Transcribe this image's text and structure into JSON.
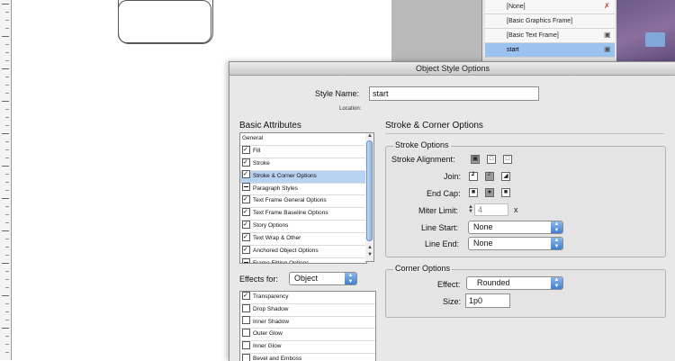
{
  "styles_panel": {
    "items": [
      {
        "label": "[None]",
        "icon": "pencil-clear-icon",
        "selected": false
      },
      {
        "label": "[Basic Graphics Frame]",
        "icon": "",
        "selected": false
      },
      {
        "label": "[Basic Text Frame]",
        "icon": "text-frame-icon",
        "selected": false
      },
      {
        "label": "start",
        "icon": "style-icon",
        "selected": true
      }
    ]
  },
  "dialog": {
    "title": "Object Style Options",
    "style_name_label": "Style Name:",
    "style_name_value": "start",
    "location_label": "Location:",
    "basic_attributes_title": "Basic Attributes",
    "attributes": [
      {
        "label": "General",
        "checkbox": "none"
      },
      {
        "label": "Fill",
        "checkbox": "checked"
      },
      {
        "label": "Stroke",
        "checkbox": "checked"
      },
      {
        "label": "Stroke & Corner Options",
        "checkbox": "checked",
        "selected": true
      },
      {
        "label": "Paragraph Styles",
        "checkbox": "mixed"
      },
      {
        "label": "Text Frame General Options",
        "checkbox": "checked"
      },
      {
        "label": "Text Frame Baseline Options",
        "checkbox": "checked"
      },
      {
        "label": "Story Options",
        "checkbox": "checked"
      },
      {
        "label": "Text Wrap & Other",
        "checkbox": "checked"
      },
      {
        "label": "Anchored Object Options",
        "checkbox": "checked"
      },
      {
        "label": "Frame Fitting Options",
        "checkbox": "mixed"
      }
    ],
    "effects_for_label": "Effects for:",
    "effects_for_value": "Object",
    "effects": [
      {
        "label": "Transparency",
        "checkbox": "checked"
      },
      {
        "label": "Drop Shadow",
        "checkbox": "unchecked"
      },
      {
        "label": "Inner Shadow",
        "checkbox": "unchecked"
      },
      {
        "label": "Outer Glow",
        "checkbox": "unchecked"
      },
      {
        "label": "Inner Glow",
        "checkbox": "unchecked"
      },
      {
        "label": "Bevel and Emboss",
        "checkbox": "unchecked"
      }
    ],
    "section_title": "Stroke & Corner Options",
    "stroke_options": {
      "title": "Stroke Options",
      "alignment_label": "Stroke Alignment:",
      "join_label": "Join:",
      "end_cap_label": "End Cap:",
      "miter_label": "Miter Limit:",
      "miter_value": "4",
      "miter_suffix": "x",
      "line_start_label": "Line Start:",
      "line_start_value": "None",
      "line_end_label": "Line End:",
      "line_end_value": "None"
    },
    "corner_options": {
      "title": "Corner Options",
      "effect_label": "Effect:",
      "effect_value": "Rounded",
      "size_label": "Size:",
      "size_value": "1p0"
    }
  }
}
